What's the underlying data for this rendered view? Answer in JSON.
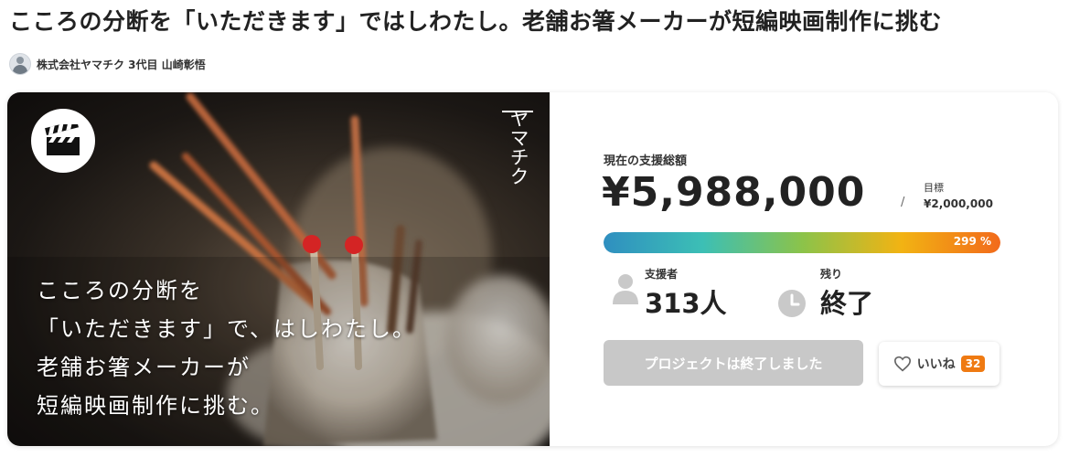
{
  "page": {
    "title": "こころの分断を「いただきます」ではしわたし。老舗お箸メーカーが短編映画制作に挑む"
  },
  "author": {
    "name": "株式会社ヤマチク 3代目 山崎彰悟"
  },
  "hero": {
    "brand": "ヤマチク",
    "copy_lines": [
      "こころの分断を",
      "「いただきます」で、はしわたし。",
      "老舗お箸メーカーが",
      "短編映画制作に挑む。"
    ],
    "badge_icon": "clapperboard-icon"
  },
  "funding": {
    "total_label": "現在の支援総額",
    "total_amount": "¥5,988,000",
    "separator": "/",
    "goal_label": "目標",
    "goal_amount": "¥2,000,000",
    "percent_text": "299 %",
    "percent_value": 299,
    "bar_fill_fraction": 1.0
  },
  "stats": {
    "supporters_label": "支援者",
    "supporters_value": "313人",
    "supporters_icon": "person-icon",
    "remaining_label": "残り",
    "remaining_value": "終了",
    "remaining_icon": "clock-icon"
  },
  "actions": {
    "ended_label": "プロジェクトは終了しました",
    "like_label": "いいね",
    "like_count": "32",
    "like_icon": "heart-icon"
  },
  "colors": {
    "accent_orange": "#ef7a12",
    "disabled_gray": "#c8c8c8",
    "progress_start": "#2f8fc0",
    "progress_end": "#f26a1b"
  }
}
